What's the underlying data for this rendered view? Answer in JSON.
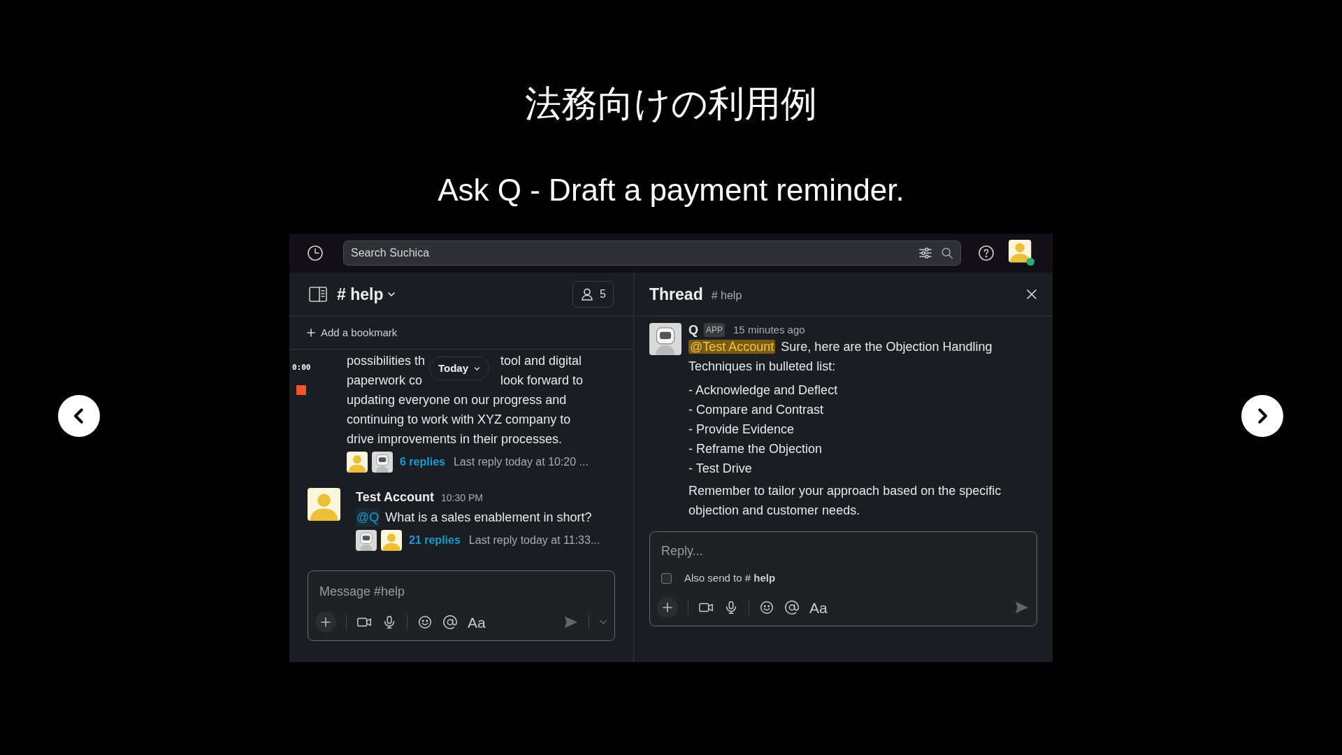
{
  "slide": {
    "title": "法務向けの利用例",
    "subtitle": "Ask Q - Draft a payment reminder."
  },
  "app": {
    "search": {
      "placeholder": "Search Suchica"
    },
    "channel": {
      "name": "# help",
      "member_count": "5",
      "bookmark": "Add a bookmark"
    },
    "recording": {
      "time": "0:00"
    },
    "date_divider": "Today",
    "messages": [
      {
        "kind": "continuation",
        "lines": [
          [
            "possibilities th",
            "tool and digital"
          ],
          [
            "paperwork co",
            "look forward to"
          ],
          [
            "updating everyone on our progress and"
          ],
          [
            "continuing to work with XYZ company to"
          ],
          [
            "drive improvements in their processes."
          ]
        ],
        "replies": {
          "avatars": [
            {
              "kind": "user"
            },
            {
              "kind": "bot"
            }
          ],
          "count": "6 replies",
          "last": "Last reply today at 10:20 ..."
        }
      },
      {
        "kind": "full",
        "avatar": {
          "kind": "user"
        },
        "author": "Test Account",
        "time": "10:30 PM",
        "mention": "@Q",
        "text": "What is a sales enablement in short?",
        "replies": {
          "avatars": [
            {
              "kind": "bot"
            },
            {
              "kind": "user"
            }
          ],
          "count": "21 replies",
          "last": "Last reply today at 11:33..."
        }
      }
    ],
    "composer": {
      "placeholder": "Message #help",
      "format_label": "Aa"
    },
    "thread": {
      "title": "Thread",
      "channel": "# help",
      "message": {
        "avatar": {
          "kind": "bot"
        },
        "author": "Q",
        "badge": "APP",
        "time": "15 minutes ago",
        "mention": "@Test Account",
        "text": "Sure, here are the Objection Handling Techniques in bulleted list:",
        "bullets": [
          "- Acknowledge and Deflect",
          "- Compare and Contrast",
          "- Provide Evidence",
          "- Reframe the Objection",
          "- Test Drive"
        ],
        "closing": "Remember to tailor your approach based on the specific objection and customer needs."
      },
      "reply": {
        "placeholder": "Reply...",
        "also_send_label": "Also send to # **help**",
        "also_send_checked": false,
        "format_label": "Aa"
      }
    }
  }
}
